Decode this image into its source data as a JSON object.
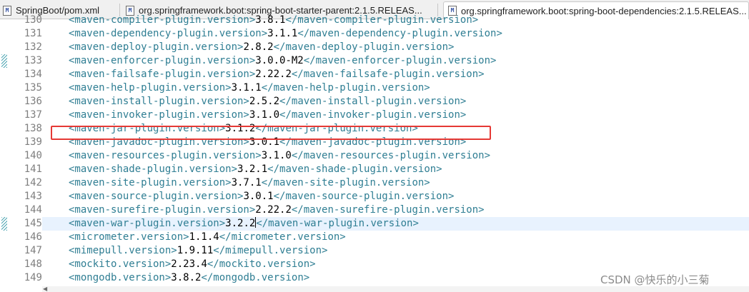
{
  "tabs": [
    {
      "label": "SpringBoot/pom.xml",
      "active": false
    },
    {
      "label": "org.springframework.boot:spring-boot-starter-parent:2.1.5.RELEAS...",
      "active": false
    },
    {
      "label": "org.springframework.boot:spring-boot-dependencies:2.1.5.RELEAS...",
      "active": true
    }
  ],
  "tab_icon_letter": "M",
  "colors": {
    "tag": "#2f7e93",
    "value": "#000000",
    "highlight_box": "#e53935",
    "current_line": "#e8f2fe"
  },
  "lines": [
    {
      "num": "130",
      "open": "<maven-compiler-plugin.version>",
      "value": "3.8.1",
      "close": "</maven-compiler-plugin.version>"
    },
    {
      "num": "131",
      "open": "<maven-dependency-plugin.version>",
      "value": "3.1.1",
      "close": "</maven-dependency-plugin.version>"
    },
    {
      "num": "132",
      "open": "<maven-deploy-plugin.version>",
      "value": "2.8.2",
      "close": "</maven-deploy-plugin.version>"
    },
    {
      "num": "133",
      "open": "<maven-enforcer-plugin.version>",
      "value": "3.0.0-M2",
      "close": "</maven-enforcer-plugin.version>"
    },
    {
      "num": "134",
      "open": "<maven-failsafe-plugin.version>",
      "value": "2.22.2",
      "close": "</maven-failsafe-plugin.version>"
    },
    {
      "num": "135",
      "open": "<maven-help-plugin.version>",
      "value": "3.1.1",
      "close": "</maven-help-plugin.version>"
    },
    {
      "num": "136",
      "open": "<maven-install-plugin.version>",
      "value": "2.5.2",
      "close": "</maven-install-plugin.version>"
    },
    {
      "num": "137",
      "open": "<maven-invoker-plugin.version>",
      "value": "3.1.0",
      "close": "</maven-invoker-plugin.version>"
    },
    {
      "num": "138",
      "open": "<maven-jar-plugin.version>",
      "value": "3.1.2",
      "close": "</maven-jar-plugin.version>"
    },
    {
      "num": "139",
      "open": "<maven-javadoc-plugin.version>",
      "value": "3.0.1",
      "close": "</maven-javadoc-plugin.version>"
    },
    {
      "num": "140",
      "open": "<maven-resources-plugin.version>",
      "value": "3.1.0",
      "close": "</maven-resources-plugin.version>"
    },
    {
      "num": "141",
      "open": "<maven-shade-plugin.version>",
      "value": "3.2.1",
      "close": "</maven-shade-plugin.version>"
    },
    {
      "num": "142",
      "open": "<maven-site-plugin.version>",
      "value": "3.7.1",
      "close": "</maven-site-plugin.version>"
    },
    {
      "num": "143",
      "open": "<maven-source-plugin.version>",
      "value": "3.0.1",
      "close": "</maven-source-plugin.version>"
    },
    {
      "num": "144",
      "open": "<maven-surefire-plugin.version>",
      "value": "2.22.2",
      "close": "</maven-surefire-plugin.version>"
    },
    {
      "num": "145",
      "open": "<maven-war-plugin.version>",
      "value": "3.2.2",
      "close": "</maven-war-plugin.version>"
    },
    {
      "num": "146",
      "open": "<micrometer.version>",
      "value": "1.1.4",
      "close": "</micrometer.version>"
    },
    {
      "num": "147",
      "open": "<mimepull.version>",
      "value": "1.9.11",
      "close": "</mimepull.version>"
    },
    {
      "num": "148",
      "open": "<mockito.version>",
      "value": "2.23.4",
      "close": "</mockito.version>"
    },
    {
      "num": "149",
      "open": "<mongodb.version>",
      "value": "3.8.2",
      "close": "</mongodb.version>"
    }
  ],
  "current_line": "145",
  "highlighted_line": "138",
  "marker_lines": [
    "133",
    "145"
  ],
  "watermark": "CSDN @快乐的小三菊"
}
